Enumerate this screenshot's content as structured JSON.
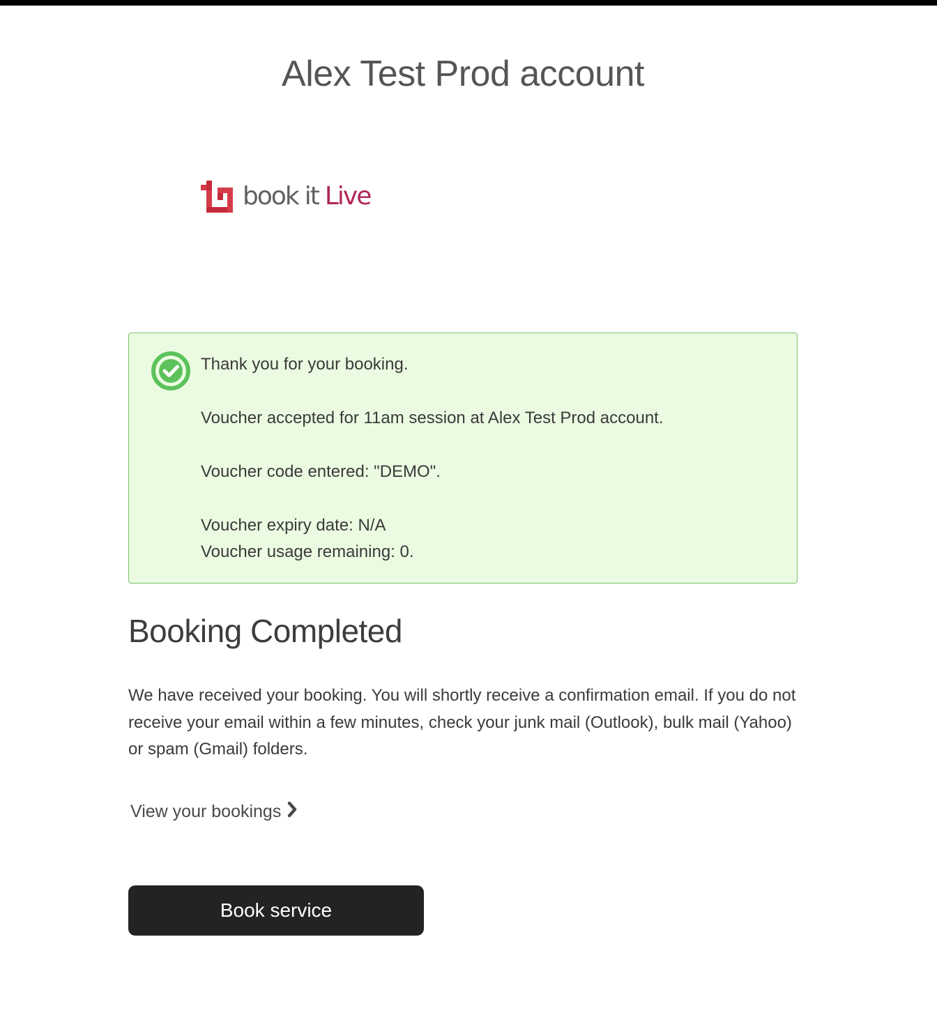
{
  "header": {
    "title": "Alex Test Prod account"
  },
  "logo": {
    "word_book": "book",
    "word_it": "it",
    "word_live": "Live",
    "icon": "bookitlive-logo-icon",
    "colors": {
      "text_gray": "#606060",
      "live_magenta": "#b0255a",
      "mark_red": "#d53c48"
    }
  },
  "alert": {
    "icon": "check-circle-icon",
    "colors": {
      "background": "#ebfbe1",
      "border": "#7cc169",
      "icon": "#5cc25b"
    },
    "thanks": "Thank you for your booking.",
    "accepted": "Voucher accepted for 11am session at Alex Test Prod account.",
    "code": "Voucher code entered: \"DEMO\".",
    "expiry": "Voucher expiry date: N/A",
    "usage": "Voucher usage remaining: 0."
  },
  "main": {
    "heading": "Booking Completed",
    "body": "We have received your booking. You will shortly receive a confirmation email. If you do not receive your email within a few minutes, check your junk mail (Outlook), bulk mail (Yahoo) or spam (Gmail) folders.",
    "view_bookings_label": "View your bookings",
    "view_bookings_icon": "chevron-right-icon",
    "book_service_label": "Book service"
  }
}
